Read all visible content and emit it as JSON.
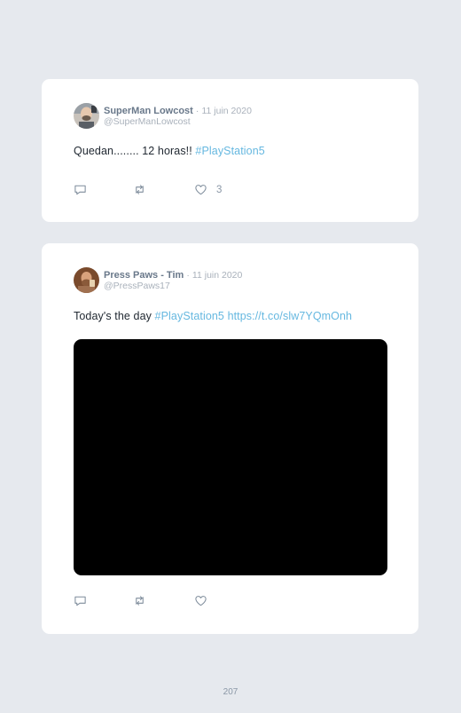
{
  "tweets": [
    {
      "name": "SuperMan Lowcost",
      "separator": "·",
      "date": "11 juin 2020",
      "handle": "@SuperManLowcost",
      "text_plain": "Quedan........ 12 horas!! ",
      "text_link": "#PlayStation5",
      "likes": "3",
      "avatar_icon": "bald-man-avatar"
    },
    {
      "name": "Press Paws - Tim",
      "separator": "·",
      "date": "11 juin 2020",
      "handle": "@PressPaws17",
      "text_plain": "Today's the day ",
      "text_link": "#PlayStation5",
      "text_link2": "https://t.co/slw7YQmOnh",
      "has_media": true,
      "avatar_icon": "bearded-man-avatar"
    }
  ],
  "icons": {
    "reply": "comment-icon",
    "retweet": "retweet-icon",
    "like": "heart-icon"
  },
  "colors": {
    "background": "#e6e9ee",
    "card": "#ffffff",
    "link": "#66b8e0",
    "name": "#69788a",
    "muted": "#a9b1bb"
  },
  "page_number": "207"
}
